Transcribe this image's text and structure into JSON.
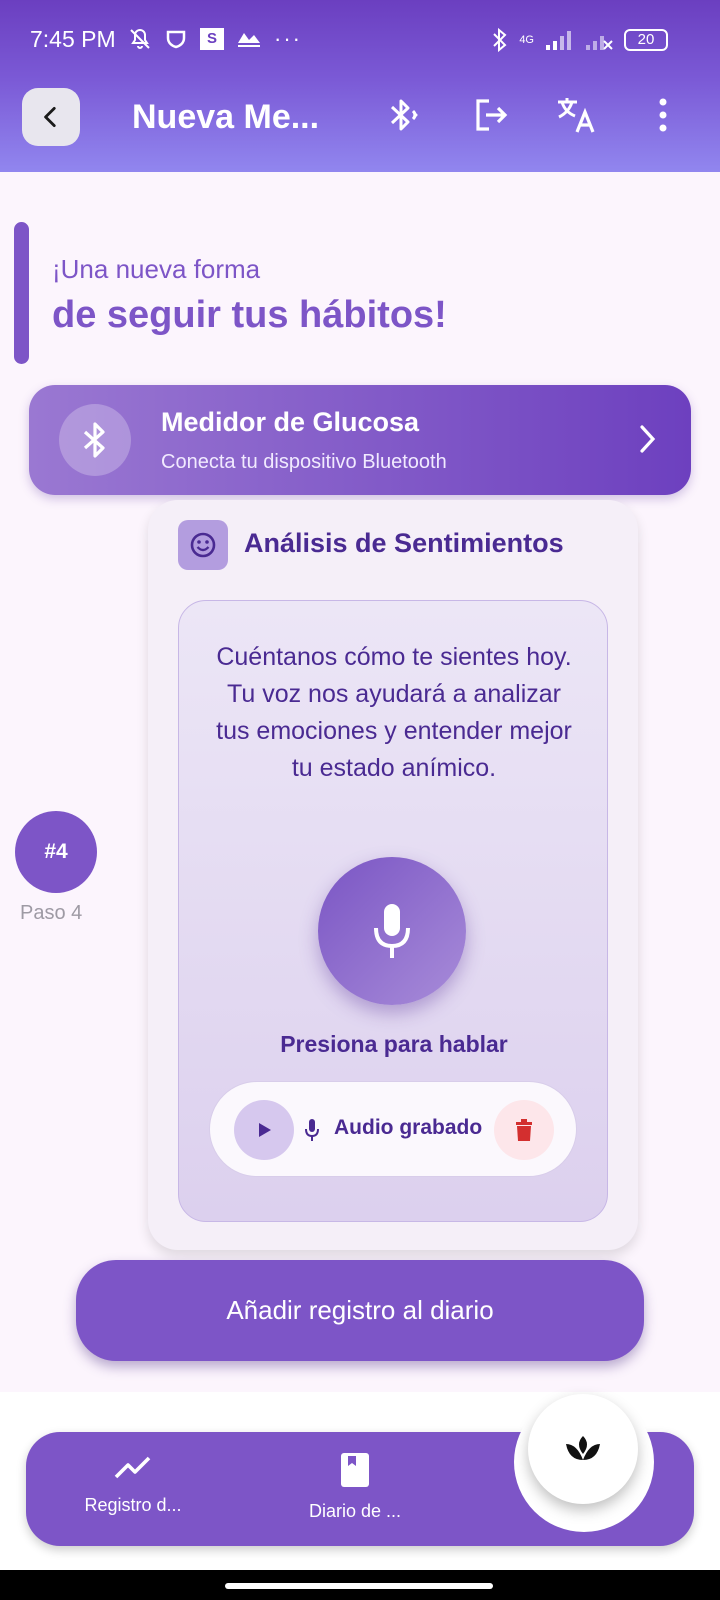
{
  "status_bar": {
    "time": "7:45 PM",
    "net_label": "4G",
    "battery": "20",
    "more": "···",
    "box_letter": "S"
  },
  "app_bar": {
    "title": "Nueva Me...",
    "icons": [
      "back-icon",
      "bluetooth-audio-icon",
      "logout-icon",
      "translate-icon",
      "more-vert-icon"
    ]
  },
  "hero": {
    "subtitle": "¡Una nueva forma",
    "title": "de seguir tus hábitos!"
  },
  "device_card": {
    "title": "Medidor de Glucosa",
    "subtitle": "Conecta tu dispositivo Bluetooth",
    "icon": "bluetooth-icon"
  },
  "sentiment": {
    "title": "Análisis de Sentimientos",
    "prompt": "Cuéntanos cómo te sientes hoy. Tu voz nos ayudará a analizar tus emociones y entender mejor tu estado anímico.",
    "mic_label": "Presiona para hablar",
    "audio_label": "Audio grabado"
  },
  "step": {
    "number": "#4",
    "label": "Paso 4"
  },
  "add_button": {
    "label": "Añadir registro al diario"
  },
  "bottom_nav": {
    "items": [
      {
        "label": "Registro d...",
        "icon": "trending-up-icon"
      },
      {
        "label": "Diario de ...",
        "icon": "book-icon"
      }
    ],
    "fab_icon": "lotus-icon"
  },
  "colors": {
    "primary": "#7d55c7",
    "dark_text": "#4a2a92",
    "background": "#fcf5fd",
    "delete": "#d32f2f"
  }
}
